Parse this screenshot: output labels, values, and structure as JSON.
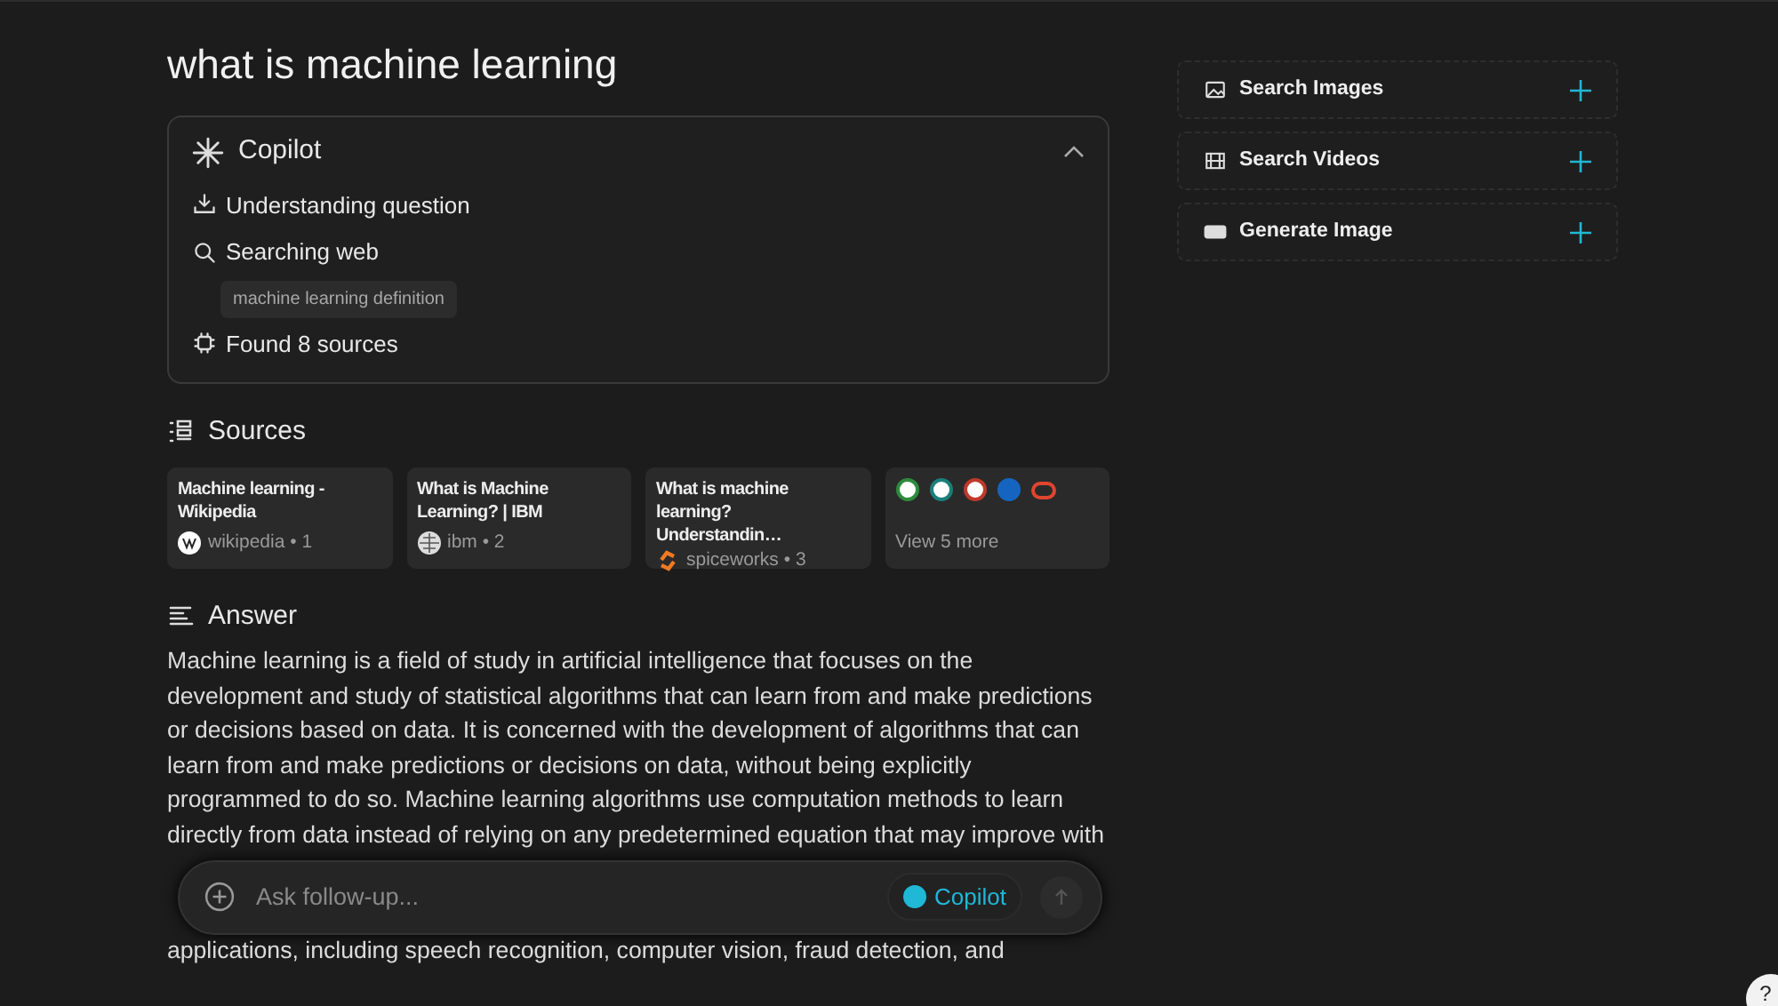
{
  "query": "what is machine learning",
  "copilot": {
    "title": "Copilot",
    "expanded": true,
    "steps": [
      {
        "kind": "understand",
        "text": "Understanding question"
      },
      {
        "kind": "search",
        "text": "Searching web",
        "chips": [
          "machine learning definition"
        ]
      },
      {
        "kind": "found",
        "text": "Found 8 sources"
      }
    ]
  },
  "sources": {
    "title": "Sources",
    "items": [
      {
        "title": "Machine learning - Wikipedia",
        "meta": "wikipedia • 1"
      },
      {
        "title": "What is Machine Learning? | IBM",
        "meta": "ibm • 2"
      },
      {
        "title": "What is machine learning? Understandin…",
        "meta": "spiceworks • 3"
      }
    ],
    "more": {
      "label": "View 5 more",
      "icons": [
        {
          "color": "#2e8b3e"
        },
        {
          "color": "#1a7f7a"
        },
        {
          "color": "#c0392b"
        },
        {
          "color": "#1565c0"
        },
        {
          "color": "#e0452f"
        }
      ]
    }
  },
  "answer": {
    "title": "Answer",
    "text": "Machine learning is a field of study in artificial intelligence that focuses on the development and study of statistical algorithms that can learn from and make predictions or decisions based on data. It is concerned with the development of algorithms that can learn from and make predictions or decisions on data, without being explicitly programmed to do so. Machine learning algorithms use computation methods to learn directly from data instead of relying on any predetermined equation that may improve with",
    "tail": "applications, including speech recognition, computer vision, fraud detection, and"
  },
  "followup": {
    "placeholder": "Ask follow-up...",
    "mode": "Copilot",
    "mode_on": true
  },
  "actions": [
    {
      "kind": "images",
      "label": "Search Images"
    },
    {
      "kind": "videos",
      "label": "Search Videos"
    },
    {
      "kind": "generate",
      "label": "Generate Image"
    }
  ],
  "help": "?"
}
